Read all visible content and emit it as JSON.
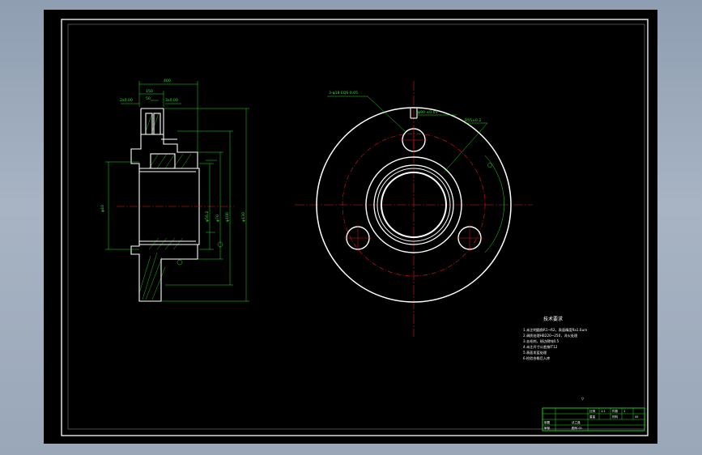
{
  "colors": {
    "outline": "#ffffff",
    "dimension": "#22dd22",
    "centerline": "#e01818",
    "frame": "#ffffff",
    "hatch": "#22dd22"
  },
  "dimensions": {
    "top_overall": "400",
    "top_step": "150",
    "top_groove": "50",
    "left_small": "2x0.00",
    "right_small": "3x0.00",
    "left_dia": "φ40",
    "d1": "φ56.2",
    "d2": "φ70",
    "d3": "φ100",
    "d4": "φ130",
    "hole_note": "3-φ18 EQS 0.05",
    "pcd_note": "φ90 ±0.05",
    "radius_note": "R55±0.2"
  },
  "notes": {
    "title": "技术要求",
    "lines": [
      "1.未注明圆角R1~R2，表面精度Ra1.6um",
      "2.调质处理HB220~250，淬火处理",
      "3.去毛刺，锐边倒钝0.5",
      "4.未注尺寸公差按IT12",
      "5.表面发蓝处理",
      "6.检验合格后入库"
    ]
  },
  "roughness": "▽",
  "title_block": {
    "cells": [
      "比例",
      "1:1",
      "件数",
      "1",
      "重量",
      "",
      "材料",
      "45"
    ],
    "left_col": [
      "制图",
      "审核"
    ],
    "part_label": "法兰盘",
    "drawing_no": "图号-01"
  }
}
